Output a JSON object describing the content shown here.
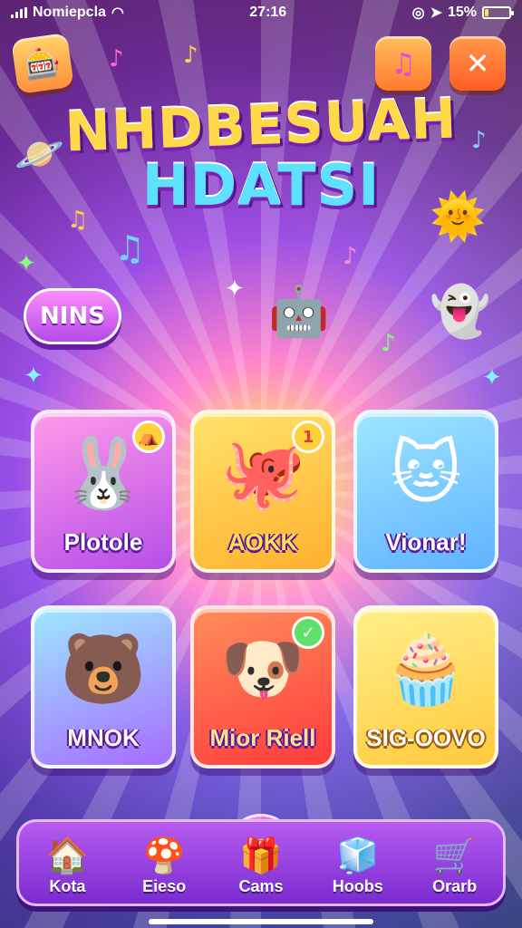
{
  "status_bar": {
    "carrier": "Nomiepcla",
    "time": "27:16",
    "battery": "15%",
    "battery_level": 0.15
  },
  "header": {
    "app_icon": "game-box-icon",
    "music_icon": "music-note-icon",
    "close_icon": "close-icon",
    "music_glyph": "♫",
    "close_glyph": "✕"
  },
  "title": {
    "line1": "NHDBESUAH",
    "line2": "HDATSI"
  },
  "badge": {
    "label": "NINS"
  },
  "games": [
    {
      "label": "Plotole",
      "icon": "sun-bunny-icon",
      "glyph": "🐰",
      "corner": "⛺"
    },
    {
      "label": "AOKK",
      "icon": "pink-blob-icon",
      "glyph": "🐙",
      "corner": "1"
    },
    {
      "label": "Vionar!",
      "icon": "cat-star-icon",
      "glyph": "🐱",
      "corner": ""
    },
    {
      "label": "MNOK",
      "icon": "bear-face-icon",
      "glyph": "🐻",
      "corner": ""
    },
    {
      "label": "Mior Riell",
      "icon": "puppy-icon",
      "glyph": "🐶",
      "corner": "✓"
    },
    {
      "label": "SIG-OOVO",
      "icon": "cupcake-icon",
      "glyph": "🧁",
      "corner": ""
    }
  ],
  "nav": [
    {
      "label": "Kota",
      "icon": "house-heart-icon",
      "glyph": "🏠"
    },
    {
      "label": "Eieso",
      "icon": "mushroom-icon",
      "glyph": "🍄"
    },
    {
      "label": "Cams",
      "icon": "gift-box-icon",
      "glyph": "🎁"
    },
    {
      "label": "Hoobs",
      "icon": "cube-icon",
      "glyph": "🧊"
    },
    {
      "label": "Orarb",
      "icon": "cart-icon",
      "glyph": "🛒"
    }
  ]
}
